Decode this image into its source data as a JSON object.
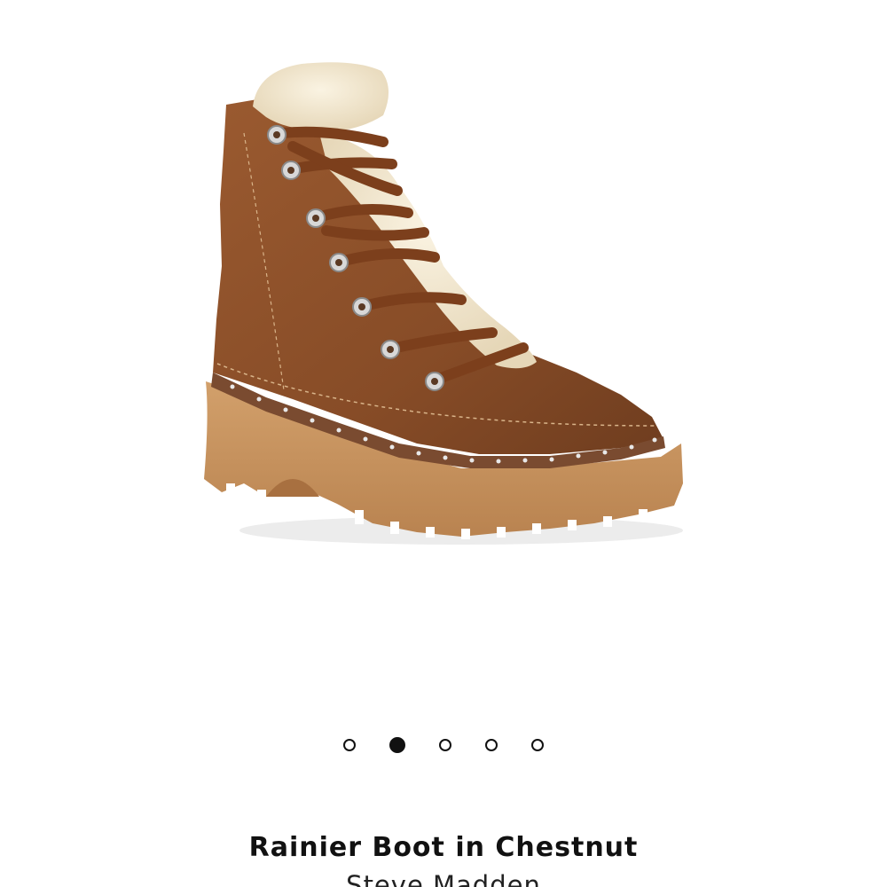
{
  "product": {
    "title": "Rainier Boot in Chestnut",
    "brand": "Steve Madden",
    "image_alt": "Rainier Boot in Chestnut"
  },
  "carousel": {
    "slide_count": 5,
    "active_index": 1
  },
  "colors": {
    "suede": "#8a4f2a",
    "sole": "#c7925c",
    "shearling": "#f1e6cf",
    "welt": "#7a4b30"
  }
}
